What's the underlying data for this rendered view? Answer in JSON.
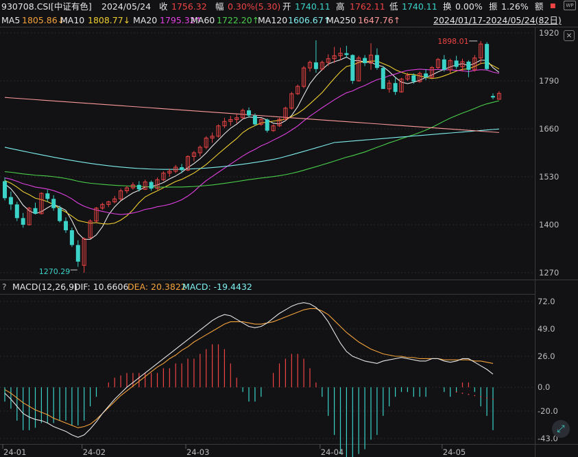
{
  "header": {
    "code": "930708.CSI[中证有色]",
    "date": "2024/05/24",
    "close_label": "收",
    "close_value": "1756.32",
    "change_label": "幅",
    "change_value": "0.30%(5.30)",
    "open_label": "开",
    "open_value": "1740.11",
    "high_label": "高",
    "high_value": "1762.11",
    "low_label": "低",
    "low_value": "1740.11",
    "turnover_label": "换",
    "turnover_value": "0.00%",
    "amplitude_label": "振",
    "amplitude_value": "1.26%",
    "amount_label": "额",
    "wp_icon": "WP"
  },
  "ma_bar": {
    "ma5_label": "MA5",
    "ma5_value": "1805.86↓",
    "ma10_label": "MA10",
    "ma10_value": "1808.77↓",
    "ma20_label": "MA20",
    "ma20_value": "1795.32↑",
    "ma60_label": "MA60",
    "ma60_value": "1722.20↑",
    "ma120_label": "MA120",
    "ma120_value": "1606.67↑",
    "ma250_label": "MA250",
    "ma250_value": "1647.76↑",
    "range": "2024/01/17-2024/05/24(82日)",
    "close_icon": "×"
  },
  "macd_bar": {
    "help": "?",
    "title": "MACD(12,26,9)",
    "dif_label": "DIF: 10.6606",
    "dea_label": "DEA: 20.3822",
    "macd_label": "MACD: -19.4432"
  },
  "chart_data": [
    {
      "type": "candlestick",
      "y_ticks": [
        "1920",
        "1790",
        "1660",
        "1530",
        "1400",
        "1270"
      ],
      "ylim": [
        1250,
        1935
      ],
      "annotations": [
        {
          "label": "1898.01"
        },
        {
          "label": "1270.29"
        }
      ],
      "colors": {
        "up": "#f04444",
        "down": "#3bd3c8",
        "ma5": "#e6e6e6",
        "ma10": "#f0d030",
        "ma20": "#e040e0",
        "ma60": "#4ad04a",
        "ma120": "#7ff0f0",
        "ma250": "#ff9a9a"
      },
      "candles": [
        [
          1518,
          1528,
          1466,
          1472
        ],
        [
          1475,
          1490,
          1440,
          1455
        ],
        [
          1455,
          1462,
          1410,
          1418
        ],
        [
          1418,
          1432,
          1392,
          1400
        ],
        [
          1400,
          1448,
          1398,
          1445
        ],
        [
          1445,
          1460,
          1428,
          1430
        ],
        [
          1430,
          1488,
          1428,
          1485
        ],
        [
          1485,
          1495,
          1462,
          1470
        ],
        [
          1470,
          1480,
          1438,
          1445
        ],
        [
          1445,
          1452,
          1406,
          1410
        ],
        [
          1410,
          1420,
          1378,
          1385
        ],
        [
          1385,
          1392,
          1340,
          1345
        ],
        [
          1345,
          1358,
          1286,
          1300
        ],
        [
          1290,
          1366,
          1270,
          1362
        ],
        [
          1365,
          1415,
          1362,
          1410
        ],
        [
          1410,
          1448,
          1405,
          1445
        ],
        [
          1445,
          1460,
          1440,
          1455
        ],
        [
          1455,
          1465,
          1448,
          1462
        ],
        [
          1462,
          1478,
          1458,
          1470
        ],
        [
          1470,
          1498,
          1466,
          1492
        ],
        [
          1492,
          1505,
          1485,
          1500
        ],
        [
          1500,
          1515,
          1495,
          1508
        ],
        [
          1508,
          1518,
          1490,
          1496
        ],
        [
          1496,
          1522,
          1494,
          1516
        ],
        [
          1516,
          1520,
          1492,
          1498
        ],
        [
          1498,
          1528,
          1495,
          1522
        ],
        [
          1522,
          1545,
          1518,
          1540
        ],
        [
          1540,
          1552,
          1530,
          1545
        ],
        [
          1545,
          1562,
          1540,
          1556
        ],
        [
          1556,
          1565,
          1540,
          1548
        ],
        [
          1548,
          1588,
          1545,
          1585
        ],
        [
          1585,
          1600,
          1572,
          1595
        ],
        [
          1595,
          1615,
          1585,
          1610
        ],
        [
          1610,
          1640,
          1605,
          1635
        ],
        [
          1635,
          1650,
          1622,
          1640
        ],
        [
          1640,
          1672,
          1636,
          1668
        ],
        [
          1668,
          1690,
          1662,
          1680
        ],
        [
          1680,
          1695,
          1668,
          1685
        ],
        [
          1685,
          1700,
          1675,
          1690
        ],
        [
          1690,
          1715,
          1686,
          1710
        ],
        [
          1710,
          1718,
          1690,
          1696
        ],
        [
          1696,
          1702,
          1668,
          1672
        ],
        [
          1672,
          1690,
          1668,
          1685
        ],
        [
          1685,
          1688,
          1650,
          1655
        ],
        [
          1655,
          1672,
          1652,
          1668
        ],
        [
          1668,
          1690,
          1665,
          1686
        ],
        [
          1686,
          1720,
          1682,
          1716
        ],
        [
          1716,
          1760,
          1712,
          1755
        ],
        [
          1755,
          1780,
          1752,
          1775
        ],
        [
          1775,
          1830,
          1770,
          1825
        ],
        [
          1825,
          1845,
          1815,
          1840
        ],
        [
          1840,
          1900,
          1812,
          1822
        ],
        [
          1822,
          1845,
          1818,
          1840
        ],
        [
          1840,
          1862,
          1830,
          1850
        ],
        [
          1850,
          1882,
          1838,
          1858
        ],
        [
          1858,
          1880,
          1846,
          1865
        ],
        [
          1865,
          1885,
          1852,
          1860
        ],
        [
          1860,
          1862,
          1782,
          1790
        ],
        [
          1790,
          1858,
          1788,
          1852
        ],
        [
          1852,
          1860,
          1830,
          1838
        ],
        [
          1838,
          1892,
          1820,
          1860
        ],
        [
          1860,
          1878,
          1820,
          1825
        ],
        [
          1825,
          1830,
          1770,
          1768
        ],
        [
          1768,
          1792,
          1758,
          1784
        ],
        [
          1784,
          1800,
          1752,
          1760
        ],
        [
          1760,
          1798,
          1758,
          1795
        ],
        [
          1795,
          1812,
          1790,
          1805
        ],
        [
          1805,
          1810,
          1782,
          1788
        ],
        [
          1788,
          1815,
          1785,
          1810
        ],
        [
          1810,
          1822,
          1792,
          1800
        ],
        [
          1800,
          1830,
          1796,
          1826
        ],
        [
          1826,
          1852,
          1822,
          1848
        ],
        [
          1848,
          1860,
          1815,
          1820
        ],
        [
          1820,
          1850,
          1810,
          1845
        ],
        [
          1845,
          1858,
          1822,
          1828
        ],
        [
          1828,
          1850,
          1815,
          1842
        ],
        [
          1842,
          1846,
          1800,
          1820
        ],
        [
          1820,
          1860,
          1815,
          1852
        ],
        [
          1852,
          1898,
          1835,
          1890
        ],
        [
          1890,
          1895,
          1818,
          1822
        ],
        [
          1749,
          1756,
          1740,
          1745
        ],
        [
          1740,
          1762,
          1740,
          1756
        ]
      ]
    },
    {
      "type": "macd",
      "y_ticks": [
        "72.0",
        "49.0",
        "26.0",
        "0.0",
        "-20.0",
        "-43.0"
      ],
      "ylim": [
        -43,
        72
      ],
      "x_ticks": [
        "24-01",
        "24-02",
        "24-03",
        "24-04",
        "24-05"
      ],
      "series": [
        {
          "name": "DIF",
          "color": "#e6e6e6",
          "values": [
            -5,
            -10,
            -16,
            -22,
            -25,
            -27,
            -28,
            -30,
            -33,
            -35,
            -37,
            -40,
            -42,
            -40,
            -35,
            -29,
            -22,
            -16,
            -10,
            -5,
            0,
            4,
            8,
            12,
            16,
            20,
            24,
            28,
            32,
            36,
            40,
            44,
            48,
            52,
            56,
            59,
            61,
            60,
            57,
            54,
            51,
            50,
            51,
            54,
            58,
            62,
            65,
            68,
            70,
            71,
            70,
            67,
            62,
            55,
            46,
            37,
            30,
            26,
            24,
            22,
            21,
            20,
            22,
            23,
            24,
            25,
            24,
            23,
            22,
            22,
            24,
            24,
            22,
            21,
            22,
            24,
            24,
            21,
            18,
            15,
            11
          ]
        },
        {
          "name": "DEA",
          "color": "#f5a33a",
          "values": [
            -2,
            -5,
            -9,
            -13,
            -16,
            -19,
            -21,
            -23,
            -26,
            -28,
            -30,
            -32,
            -34,
            -33,
            -31,
            -27,
            -22,
            -17,
            -12,
            -7,
            -3,
            1,
            5,
            9,
            13,
            17,
            20,
            24,
            27,
            31,
            34,
            38,
            41,
            44,
            47,
            50,
            53,
            55,
            55,
            55,
            54,
            53,
            53,
            54,
            55,
            57,
            59,
            61,
            63,
            65,
            66,
            66,
            64,
            61,
            56,
            51,
            46,
            42,
            38,
            35,
            32,
            30,
            28,
            27,
            26,
            26,
            25,
            25,
            24,
            24,
            24,
            24,
            23,
            23,
            23,
            23,
            23,
            22,
            22,
            21,
            20
          ]
        },
        {
          "name": "MACD",
          "colors": {
            "up": "#f04444",
            "down": "#3bd3c8"
          },
          "values": [
            -6,
            -9,
            -14,
            -18,
            -18,
            -17,
            -15,
            -15,
            -15,
            -14,
            -14,
            -16,
            -16,
            -14,
            -8,
            -4,
            0,
            2,
            4,
            5,
            6,
            6,
            6,
            6,
            6,
            6,
            8,
            8,
            10,
            10,
            12,
            12,
            14,
            16,
            18,
            18,
            16,
            10,
            4,
            -2,
            -6,
            -6,
            -4,
            0,
            6,
            10,
            12,
            14,
            14,
            12,
            8,
            2,
            -4,
            -12,
            -20,
            -28,
            -32,
            -32,
            -28,
            -26,
            -22,
            -20,
            -12,
            -8,
            -4,
            -2,
            -2,
            -4,
            -4,
            -4,
            0,
            0,
            -2,
            -4,
            -2,
            2,
            2,
            -2,
            -8,
            -12,
            -18
          ]
        }
      ],
      "dots": [
        -4,
        -5,
        -6,
        -7,
        -8,
        -9,
        -10
      ]
    }
  ]
}
